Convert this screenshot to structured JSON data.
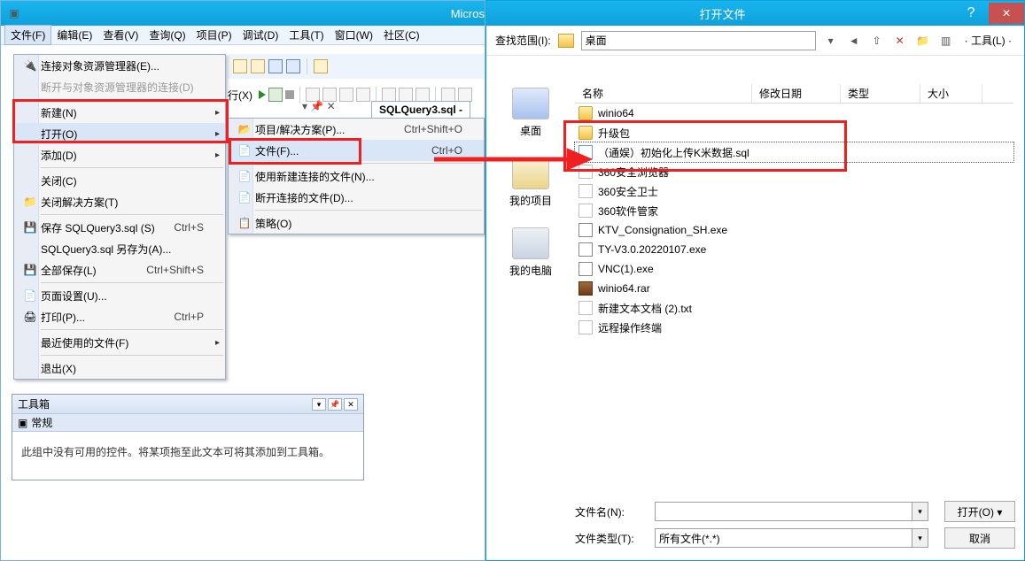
{
  "left": {
    "title": "Micros",
    "menubar": [
      "文件(F)",
      "编辑(E)",
      "查看(V)",
      "查询(Q)",
      "项目(P)",
      "调试(D)",
      "工具(T)",
      "窗口(W)",
      "社区(C)"
    ],
    "fileMenu": {
      "connect": "连接对象资源管理器(E)...",
      "disconnect": "断开与对象资源管理器的连接(D)",
      "new": "新建(N)",
      "open": "打开(O)",
      "add": "添加(D)",
      "close": "关闭(C)",
      "closeSolution": "关闭解决方案(T)",
      "save": "保存 SQLQuery3.sql (S)",
      "saveShortcut": "Ctrl+S",
      "saveAs": "SQLQuery3.sql 另存为(A)...",
      "saveAll": "全部保存(L)",
      "saveAllShortcut": "Ctrl+Shift+S",
      "pageSetup": "页面设置(U)...",
      "print": "打印(P)...",
      "printShortcut": "Ctrl+P",
      "recent": "最近使用的文件(F)",
      "exit": "退出(X)"
    },
    "openSub": {
      "projSln": "项目/解决方案(P)...",
      "projSlnShort": "Ctrl+Shift+O",
      "file": "文件(F)...",
      "fileShort": "Ctrl+O",
      "newConnFile": "使用新建连接的文件(N)...",
      "disconnFile": "断开连接的文件(D)...",
      "policy": "策略(O)"
    },
    "execLabel": "行(X)",
    "docTab": "SQLQuery3.sql -",
    "tabpin": "▾   📌   ✕",
    "toolbox": {
      "title": "工具箱",
      "group": "常规",
      "empty": "此组中没有可用的控件。将某项拖至此文本可将其添加到工具箱。"
    }
  },
  "right": {
    "title": "打开文件",
    "lookInLabel": "查找范围(I):",
    "lookInValue": "桌面",
    "toolsLabel": "· 工具(L)  ·",
    "places": {
      "desktop": "桌面",
      "projects": "我的项目",
      "computer": "我的电脑"
    },
    "columns": {
      "name": "名称",
      "modified": "修改日期",
      "type": "类型",
      "size": "大小"
    },
    "files": [
      {
        "ico": "folder",
        "name": "winio64"
      },
      {
        "ico": "folder",
        "name": "升级包"
      },
      {
        "ico": "sql",
        "name": "（通娱）初始化上传K米数据.sql",
        "sel": true
      },
      {
        "ico": "gen",
        "name": "360安全浏览器"
      },
      {
        "ico": "gen",
        "name": "360安全卫士"
      },
      {
        "ico": "gen",
        "name": "360软件管家"
      },
      {
        "ico": "exe",
        "name": "KTV_Consignation_SH.exe"
      },
      {
        "ico": "exe",
        "name": "TY-V3.0.20220107.exe"
      },
      {
        "ico": "exe",
        "name": "VNC(1).exe"
      },
      {
        "ico": "rar",
        "name": "winio64.rar"
      },
      {
        "ico": "gen",
        "name": "新建文本文档 (2).txt"
      },
      {
        "ico": "gen",
        "name": "远程操作终端"
      }
    ],
    "fileNameLabel": "文件名(N):",
    "fileNameValue": "",
    "fileTypeLabel": "文件类型(T):",
    "fileTypeValue": "所有文件(*.*)",
    "openBtn": "打开(O)",
    "cancelBtn": "取消"
  }
}
